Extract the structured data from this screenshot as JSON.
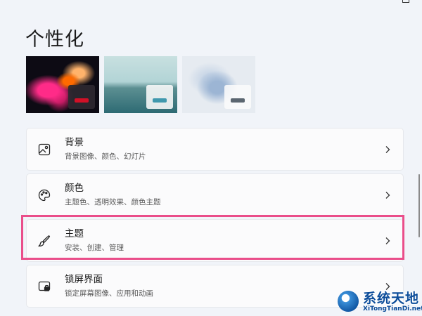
{
  "window_controls": {
    "minimize_icon": "minimize-icon",
    "maximize_icon": "maximize-icon"
  },
  "page": {
    "title": "个性化"
  },
  "themes": [
    {
      "name": "theme-dark-bloom",
      "accent": "#d21027"
    },
    {
      "name": "theme-lake",
      "accent": "#3f98ad"
    },
    {
      "name": "theme-flow",
      "accent": "#5b6670"
    }
  ],
  "settings": [
    {
      "title": "背景",
      "subtitle": "背景图像、颜色、幻灯片",
      "icon": "image-icon"
    },
    {
      "title": "颜色",
      "subtitle": "主题色、透明效果、颜色主题",
      "icon": "palette-icon"
    },
    {
      "title": "主题",
      "subtitle": "安装、创建、管理",
      "icon": "brush-icon"
    },
    {
      "title": "锁屏界面",
      "subtitle": "锁定屏幕图像、应用和动画",
      "icon": "lock-screen-icon"
    }
  ],
  "highlight_color": "#ea4e8a",
  "watermark": {
    "text_cn": "系统天地",
    "text_en": "XiTongTianDi.net"
  }
}
